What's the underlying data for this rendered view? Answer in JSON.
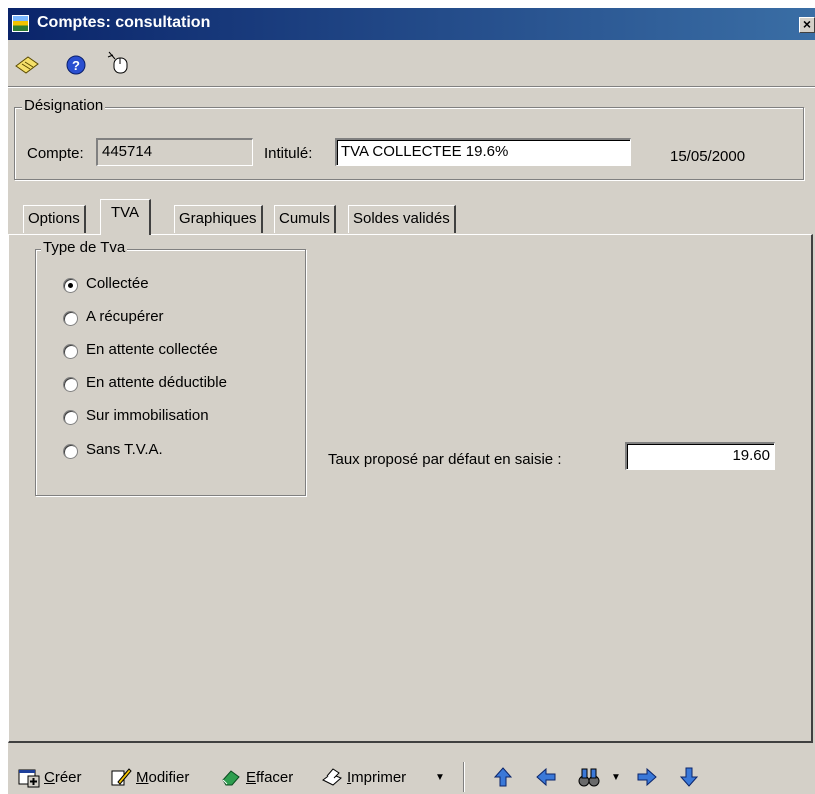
{
  "window": {
    "title": "Comptes: consultation",
    "close_symbol": "×"
  },
  "toolbar_icons": [
    "notepad-icon",
    "help-icon",
    "mouse-pointer-icon"
  ],
  "designation": {
    "legend": "Désignation",
    "compte_label": "Compte:",
    "compte_value": "445714",
    "intitule_label": "Intitulé:",
    "intitule_value": "TVA COLLECTEE  19.6%",
    "date": "15/05/2000"
  },
  "tabs": [
    {
      "label": "Options",
      "active": false
    },
    {
      "label": "TVA",
      "active": true
    },
    {
      "label": "Graphiques",
      "active": false
    },
    {
      "label": "Cumuls",
      "active": false
    },
    {
      "label": "Soldes validés",
      "active": false
    }
  ],
  "tva": {
    "group_legend": "Type de Tva",
    "options": [
      {
        "label": "Collectée",
        "checked": true
      },
      {
        "label": "A récupérer",
        "checked": false
      },
      {
        "label": "En attente collectée",
        "checked": false
      },
      {
        "label": "En attente déductible",
        "checked": false
      },
      {
        "label": "Sur immobilisation",
        "checked": false
      },
      {
        "label": "Sans T.V.A.",
        "checked": false
      }
    ],
    "taux_label": "Taux proposé par défaut en saisie :",
    "taux_value": "19.60"
  },
  "bottom_bar": {
    "creer_first": "C",
    "creer_rest": "réer",
    "modifier_first": "M",
    "modifier_rest": "odifier",
    "effacer_first": "E",
    "effacer_rest": "ffacer",
    "imprimer_first": "I",
    "imprimer_rest": "mprimer",
    "dropdown_arrow": "▼"
  },
  "colors": {
    "titlebar_start": "#0a246a",
    "titlebar_end": "#3a6ea5",
    "face": "#d4d0c8"
  }
}
